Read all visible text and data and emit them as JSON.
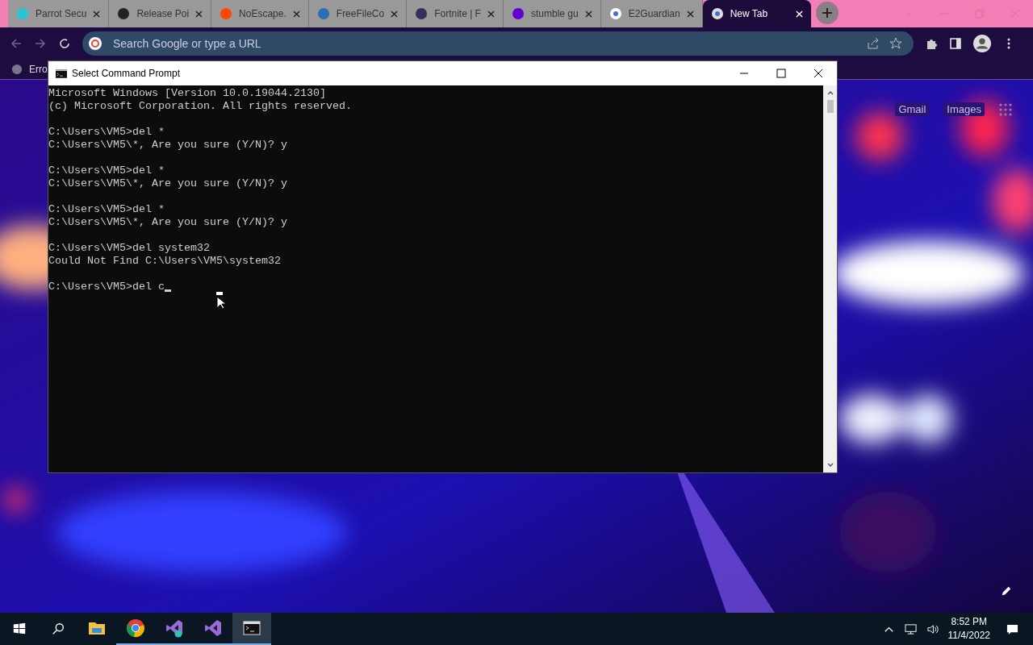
{
  "browser": {
    "tabs": [
      {
        "title": "Parrot Secu",
        "selected": false
      },
      {
        "title": "Release Poi",
        "selected": false
      },
      {
        "title": "NoEscape.",
        "selected": false
      },
      {
        "title": "FreeFileCo",
        "selected": false
      },
      {
        "title": "Fortnite | F",
        "selected": false
      },
      {
        "title": "stumble gu",
        "selected": false
      },
      {
        "title": "E2Guardian",
        "selected": false
      },
      {
        "title": "New Tab",
        "selected": true
      }
    ],
    "address": {
      "placeholder": "Search Google or type a URL"
    },
    "bookmarks": [
      "Erro"
    ],
    "ntp_links": [
      "Gmail",
      "Images"
    ]
  },
  "console": {
    "title": "Select Command Prompt",
    "blocks": [
      [
        "Microsoft Windows [Version 10.0.19044.2130]",
        "(c) Microsoft Corporation. All rights reserved."
      ],
      [
        "C:\\Users\\VM5>del *",
        "C:\\Users\\VM5\\*, Are you sure (Y/N)? y"
      ],
      [
        "C:\\Users\\VM5>del *",
        "C:\\Users\\VM5\\*, Are you sure (Y/N)? y"
      ],
      [
        "C:\\Users\\VM5>del *",
        "C:\\Users\\VM5\\*, Are you sure (Y/N)? y"
      ],
      [
        "C:\\Users\\VM5>del system32",
        "Could Not Find C:\\Users\\VM5\\system32"
      ]
    ],
    "prompt": "C:\\Users\\VM5>del c"
  },
  "taskbar": {
    "apps": [
      {
        "kind": "explorer",
        "open": false,
        "selected": false
      },
      {
        "kind": "chrome",
        "open": true,
        "selected": false
      },
      {
        "kind": "vs-installer",
        "open": true,
        "selected": false
      },
      {
        "kind": "vs",
        "open": true,
        "selected": false
      },
      {
        "kind": "terminal",
        "open": true,
        "selected": true
      }
    ],
    "time": "8:52 PM",
    "date": "11/4/2022"
  }
}
